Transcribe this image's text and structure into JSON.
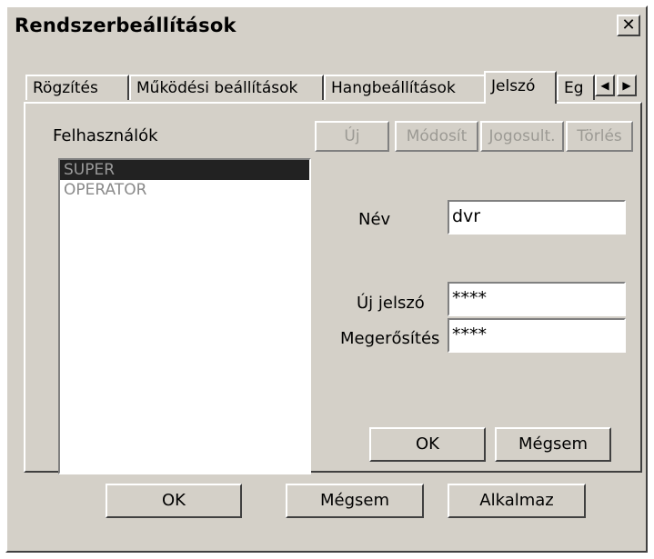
{
  "window": {
    "title": "Rendszerbeállítások",
    "close_glyph": "✕"
  },
  "tabs": [
    {
      "label": "Rögzítés",
      "active": false
    },
    {
      "label": "Működési beállítások",
      "active": false
    },
    {
      "label": "Hangbeállítások",
      "active": false
    },
    {
      "label": "Jelszó",
      "active": true
    },
    {
      "label": "Eg",
      "active": false
    }
  ],
  "tab_scroll": {
    "left_icon": "arrow-left-icon",
    "left_glyph": "◀",
    "right_icon": "arrow-right-icon",
    "right_glyph": "▶"
  },
  "users": {
    "label": "Felhasználók",
    "items": [
      {
        "name": "SUPER",
        "selected": true
      },
      {
        "name": "OPERATOR",
        "selected": false
      }
    ]
  },
  "user_toolbar": {
    "new_label": "Új",
    "modify_label": "Módosít",
    "rights_label": "Jogosult.",
    "delete_label": "Törlés",
    "disabled": true
  },
  "form": {
    "name_label": "Név",
    "name_value": "dvr",
    "new_password_label": "Új jelszó",
    "new_password_value": "****",
    "confirm_label": "Megerősítés",
    "confirm_value": "****",
    "ok_label": "OK",
    "cancel_label": "Mégsem"
  },
  "dialog_buttons": {
    "ok_label": "OK",
    "cancel_label": "Mégsem",
    "apply_label": "Alkalmaz"
  }
}
